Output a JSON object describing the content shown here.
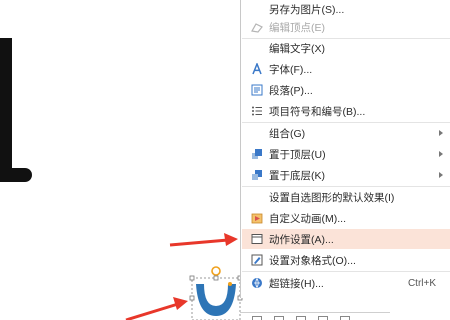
{
  "menu": {
    "items": [
      {
        "label": "另存为图片(S)...",
        "icon": "save-image-icon",
        "disabled": false
      },
      {
        "label": "编辑顶点(E)",
        "icon": "edit-vertices-icon",
        "disabled": true
      },
      {
        "label": "编辑文字(X)",
        "icon": "",
        "disabled": false
      },
      {
        "label": "字体(F)...",
        "icon": "font-icon",
        "disabled": false
      },
      {
        "label": "段落(P)...",
        "icon": "paragraph-icon",
        "disabled": false
      },
      {
        "label": "项目符号和编号(B)...",
        "icon": "bullets-icon",
        "disabled": false
      },
      {
        "label": "组合(G)",
        "icon": "",
        "submenu": true
      },
      {
        "label": "置于顶层(U)",
        "icon": "bring-to-front-icon",
        "submenu": true
      },
      {
        "label": "置于底层(K)",
        "icon": "send-to-back-icon",
        "submenu": true
      },
      {
        "label": "设置自选图形的默认效果(I)",
        "icon": ""
      },
      {
        "label": "自定义动画(M)...",
        "icon": "custom-animation-icon"
      },
      {
        "label": "动作设置(A)...",
        "icon": "action-settings-icon",
        "highlighted": true
      },
      {
        "label": "设置对象格式(O)...",
        "icon": "format-object-icon"
      },
      {
        "label": "超链接(H)...",
        "icon": "hyperlink-icon",
        "shortcut": "Ctrl+K"
      }
    ]
  },
  "colors": {
    "highlight": "#fbe3d8",
    "arrow": "#e8372a",
    "shape_fill": "#2e75b6",
    "rotate_handle": "#f0a11c"
  }
}
